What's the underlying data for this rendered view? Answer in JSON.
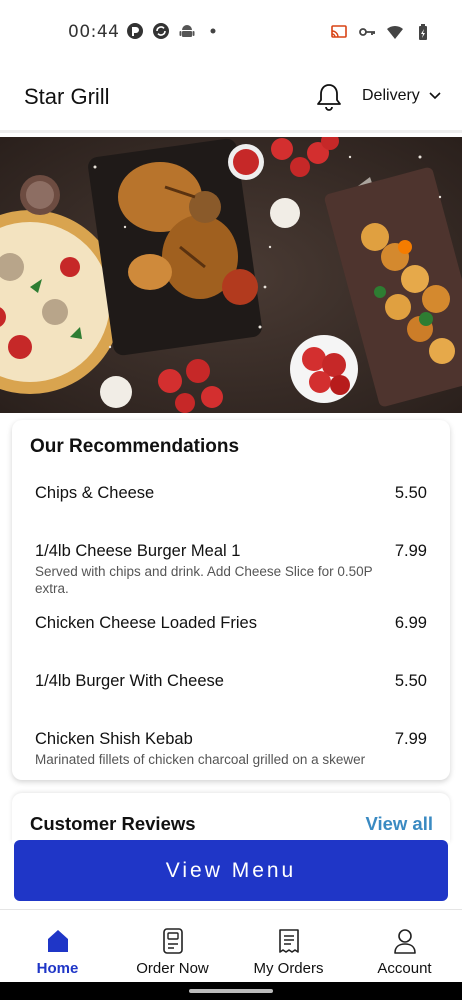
{
  "status_bar": {
    "time": "00:44",
    "left_icons": [
      "pocket-icon",
      "sync-icon",
      "android-icon",
      "dot-icon"
    ],
    "right_icons": [
      "cast-icon",
      "vpn-key-icon",
      "wifi-icon",
      "battery-icon"
    ]
  },
  "header": {
    "title": "Star Grill",
    "notification_icon": "bell-icon",
    "delivery_label": "Delivery",
    "delivery_icon": "chevron-down-icon"
  },
  "hero": {
    "image": "grilled-food-banner"
  },
  "recommendations": {
    "title": "Our Recommendations",
    "items": [
      {
        "name": "Chips & Cheese",
        "price": "5.50",
        "description": ""
      },
      {
        "name": "1/4lb Cheese Burger Meal 1",
        "price": "7.99",
        "description": "Served with chips and drink. Add Cheese Slice for 0.50P extra."
      },
      {
        "name": "Chicken Cheese Loaded Fries",
        "price": "6.99",
        "description": ""
      },
      {
        "name": "1/4lb Burger With Cheese",
        "price": "5.50",
        "description": ""
      },
      {
        "name": "Chicken Shish Kebab",
        "price": "7.99",
        "description": "Marinated fillets of chicken charcoal grilled on a skewer"
      }
    ]
  },
  "reviews": {
    "title": "Customer Reviews",
    "view_all_label": "View all"
  },
  "view_menu_button": "View Menu",
  "bottom_nav": {
    "items": [
      {
        "label": "Home",
        "icon": "home-icon",
        "active": true
      },
      {
        "label": "Order Now",
        "icon": "order-icon",
        "active": false
      },
      {
        "label": "My Orders",
        "icon": "receipt-icon",
        "active": false
      },
      {
        "label": "Account",
        "icon": "account-icon",
        "active": false
      }
    ]
  },
  "colors": {
    "primary": "#1f36c7",
    "link": "#3a8ac2",
    "text": "#111111"
  }
}
